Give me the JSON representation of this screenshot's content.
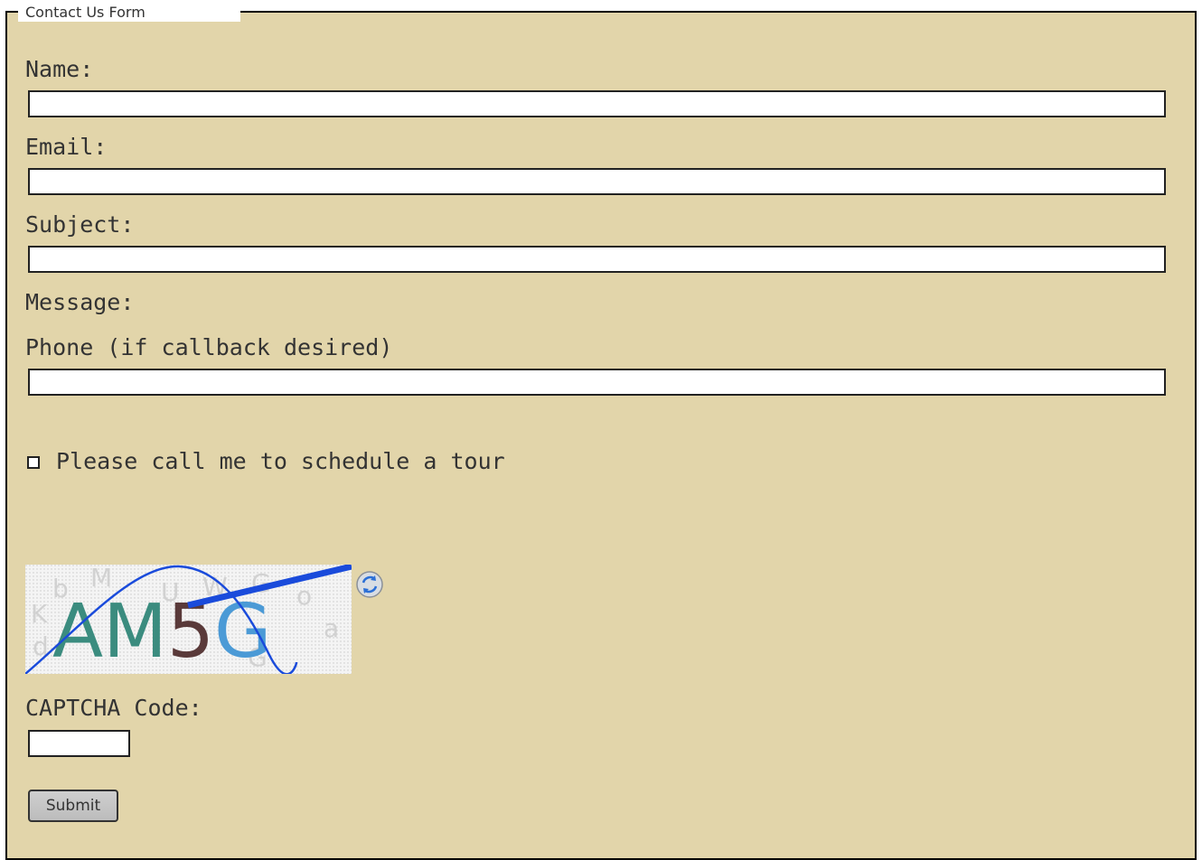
{
  "form": {
    "legend": "Contact Us Form",
    "name_label": "Name:",
    "name_value": "",
    "email_label": "Email:",
    "email_value": "",
    "subject_label": "Subject:",
    "subject_value": "",
    "message_label": "Message:",
    "phone_label": "Phone (if callback desired)",
    "phone_value": "",
    "tour_checkbox_label": "Please call me to schedule a tour",
    "tour_checked": false,
    "captcha_image_text": "AM5G",
    "captcha_label": "CAPTCHA Code:",
    "captcha_value": "",
    "submit_label": "Submit"
  },
  "icons": {
    "refresh": "refresh-icon"
  },
  "colors": {
    "form_background": "#e2d5aa",
    "border": "#000000",
    "text": "#333333",
    "captcha_char_1": "#3b8c7f",
    "captcha_char_2": "#3b8c7f",
    "captcha_char_3": "#5a3a3a",
    "captcha_char_4": "#4b9ad6",
    "captcha_line": "#1a4bdb"
  }
}
